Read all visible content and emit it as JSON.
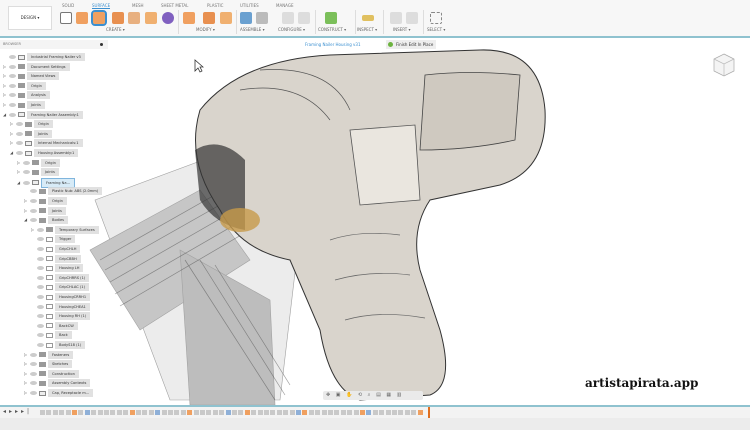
{
  "toolbar": {
    "workspace": "DESIGN ▾",
    "tabs": [
      "SOLID",
      "SURFACE",
      "MESH",
      "SHEET METAL",
      "PLASTIC",
      "UTILITIES",
      "MANAGE"
    ],
    "active_tab": "SURFACE",
    "groups": [
      "CREATE ▾",
      "MODIFY ▾",
      "ASSEMBLE ▾",
      "CONFIGURE ▾",
      "CONSTRUCT ▾",
      "INSPECT ▾",
      "INSERT ▾",
      "SELECT ▾"
    ]
  },
  "browser": {
    "title": "BROWSER",
    "items": [
      {
        "level": 0,
        "arrow": "",
        "icon": "comp",
        "label": "Industrial Framing Nailer v3"
      },
      {
        "level": 0,
        "arrow": "▷",
        "icon": "folder",
        "label": "Document Settings"
      },
      {
        "level": 0,
        "arrow": "▷",
        "icon": "folder",
        "label": "Named Views"
      },
      {
        "level": 0,
        "arrow": "▷",
        "icon": "folder",
        "label": "Origin"
      },
      {
        "level": 0,
        "arrow": "▷",
        "icon": "folder",
        "label": "Analysis"
      },
      {
        "level": 0,
        "arrow": "▷",
        "icon": "folder",
        "label": "Joints"
      },
      {
        "level": 0,
        "arrow": "◢",
        "icon": "comp",
        "label": "Framing Nailer Assembly:1"
      },
      {
        "level": 1,
        "arrow": "▷",
        "icon": "folder",
        "label": "Origin"
      },
      {
        "level": 1,
        "arrow": "▷",
        "icon": "folder",
        "label": "Joints"
      },
      {
        "level": 1,
        "arrow": "▷",
        "icon": "comp",
        "label": "Internal Mechanicals:1"
      },
      {
        "level": 1,
        "arrow": "◢",
        "icon": "comp",
        "label": "Housing Assembly:1"
      },
      {
        "level": 2,
        "arrow": "▷",
        "icon": "folder",
        "label": "Origin"
      },
      {
        "level": 2,
        "arrow": "▷",
        "icon": "folder",
        "label": "Joints"
      },
      {
        "level": 2,
        "arrow": "◢",
        "icon": "comp",
        "label": "Framing Na...",
        "active": true
      },
      {
        "level": 3,
        "arrow": "",
        "icon": "folder",
        "label": "Plastic Nub: ABS (2.0mm)"
      },
      {
        "level": 3,
        "arrow": "▷",
        "icon": "folder",
        "label": "Origin"
      },
      {
        "level": 3,
        "arrow": "▷",
        "icon": "folder",
        "label": "Joints"
      },
      {
        "level": 3,
        "arrow": "◢",
        "icon": "folder",
        "label": "Bodies"
      },
      {
        "level": 4,
        "arrow": "▷",
        "icon": "folder",
        "label": "Temporary Surfaces"
      },
      {
        "level": 4,
        "arrow": "",
        "icon": "body",
        "label": "Trigger"
      },
      {
        "level": 4,
        "arrow": "",
        "icon": "body",
        "label": "GripCHLH"
      },
      {
        "level": 4,
        "arrow": "",
        "icon": "body",
        "label": "GripCBBH"
      },
      {
        "level": 4,
        "arrow": "",
        "icon": "body",
        "label": "Housing LH"
      },
      {
        "level": 4,
        "arrow": "",
        "icon": "body",
        "label": "GripCHRRS (1)"
      },
      {
        "level": 4,
        "arrow": "",
        "icon": "body",
        "label": "GripCHLAC (1)"
      },
      {
        "level": 4,
        "arrow": "",
        "icon": "body",
        "label": "HousingCRRH1"
      },
      {
        "level": 4,
        "arrow": "",
        "icon": "body",
        "label": "HousingCHEA1"
      },
      {
        "level": 4,
        "arrow": "",
        "icon": "body",
        "label": "Housing RH (1)"
      },
      {
        "level": 4,
        "arrow": "",
        "icon": "body",
        "label": "BackCW"
      },
      {
        "level": 4,
        "arrow": "",
        "icon": "body",
        "label": "Back"
      },
      {
        "level": 4,
        "arrow": "",
        "icon": "body",
        "label": "BodyS18 (1)"
      },
      {
        "level": 3,
        "arrow": "▷",
        "icon": "folder",
        "label": "Fasteners"
      },
      {
        "level": 3,
        "arrow": "▷",
        "icon": "folder",
        "label": "Sketches"
      },
      {
        "level": 3,
        "arrow": "▷",
        "icon": "folder",
        "label": "Construction"
      },
      {
        "level": 3,
        "arrow": "▷",
        "icon": "folder",
        "label": "Assembly Contexts"
      },
      {
        "level": 3,
        "arrow": "▷",
        "icon": "comp",
        "label": "Cap, Receptacle m..."
      }
    ]
  },
  "context": {
    "active_component": "Framing Nailer Housing v31",
    "finish_button": "Finish Edit In Place"
  },
  "watermark": "artistapirata.app",
  "colors": {
    "accent": "#3a8fd0",
    "border_teal": "#8fc2cf",
    "surface_orange": "#f0a060",
    "finish_green": "#6cb33f"
  }
}
